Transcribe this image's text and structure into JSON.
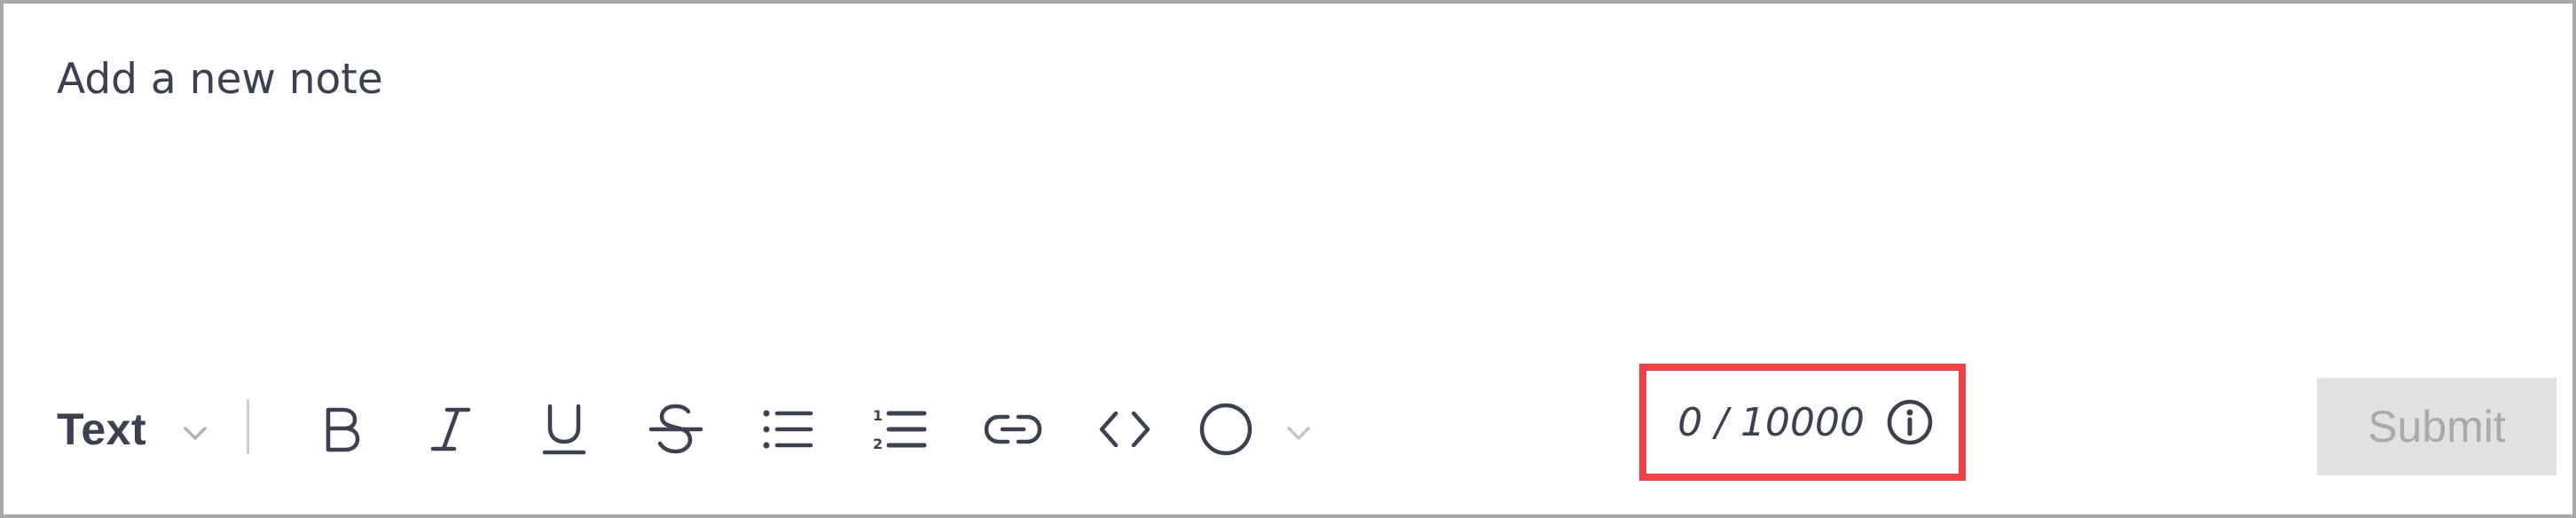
{
  "note": {
    "placeholder": "Add a new note",
    "value": ""
  },
  "toolbar": {
    "text_style_label": "Text",
    "buttons": [
      {
        "name": "bold",
        "icon": "bold-icon"
      },
      {
        "name": "italic",
        "icon": "italic-icon"
      },
      {
        "name": "underline",
        "icon": "underline-icon"
      },
      {
        "name": "strikethrough",
        "icon": "strikethrough-icon"
      },
      {
        "name": "bulleted-list",
        "icon": "bulleted-list-icon"
      },
      {
        "name": "numbered-list",
        "icon": "numbered-list-icon"
      },
      {
        "name": "link",
        "icon": "link-icon"
      },
      {
        "name": "code",
        "icon": "code-icon"
      },
      {
        "name": "color",
        "icon": "circle-icon"
      }
    ]
  },
  "counter": {
    "text": "0 / 10000",
    "icon": "info-icon"
  },
  "submit": {
    "label": "Submit"
  },
  "colors": {
    "text": "#3a4150",
    "highlight_border": "#ef4146",
    "submit_bg": "#e1e1e1",
    "submit_text": "#a9a9a9",
    "editor_border": "#a8a8a8"
  }
}
